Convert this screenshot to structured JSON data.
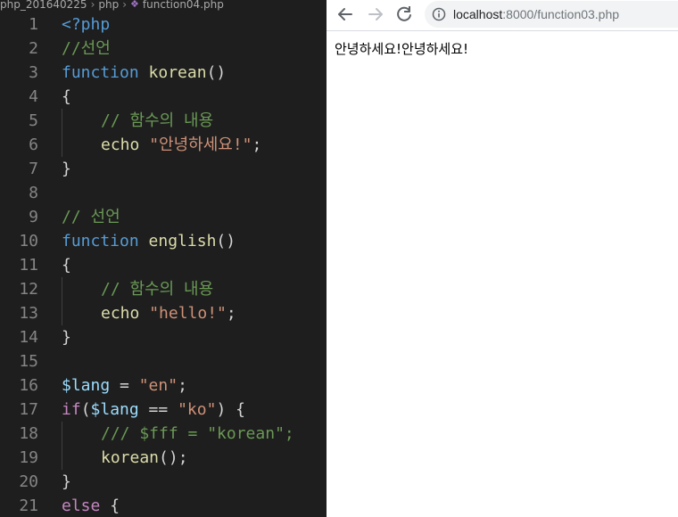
{
  "editor": {
    "breadcrumb": {
      "folder": "php_201640225",
      "subfolder": "php",
      "file": "function04.php"
    },
    "lines": [
      {
        "n": "1",
        "tokens": [
          {
            "c": "kw",
            "t": "<?php"
          }
        ]
      },
      {
        "n": "2",
        "tokens": [
          {
            "c": "cm",
            "t": "//선언"
          }
        ]
      },
      {
        "n": "3",
        "tokens": [
          {
            "c": "kw",
            "t": "function"
          },
          {
            "c": "op",
            "t": " "
          },
          {
            "c": "fn",
            "t": "korean"
          },
          {
            "c": "op",
            "t": "()"
          }
        ]
      },
      {
        "n": "4",
        "tokens": [
          {
            "c": "op",
            "t": "{"
          }
        ]
      },
      {
        "n": "5",
        "indent": true,
        "tokens": [
          {
            "c": "cm",
            "t": "// 함수의 내용"
          }
        ]
      },
      {
        "n": "6",
        "indent": true,
        "tokens": [
          {
            "c": "fn",
            "t": "echo"
          },
          {
            "c": "op",
            "t": " "
          },
          {
            "c": "str",
            "t": "\"안녕하세요!\""
          },
          {
            "c": "op",
            "t": ";"
          }
        ]
      },
      {
        "n": "7",
        "tokens": [
          {
            "c": "op",
            "t": "}"
          }
        ]
      },
      {
        "n": "8",
        "tokens": []
      },
      {
        "n": "9",
        "tokens": [
          {
            "c": "cm",
            "t": "// 선언"
          }
        ]
      },
      {
        "n": "10",
        "tokens": [
          {
            "c": "kw",
            "t": "function"
          },
          {
            "c": "op",
            "t": " "
          },
          {
            "c": "fn",
            "t": "english"
          },
          {
            "c": "op",
            "t": "()"
          }
        ]
      },
      {
        "n": "11",
        "tokens": [
          {
            "c": "op",
            "t": "{"
          }
        ]
      },
      {
        "n": "12",
        "indent": true,
        "tokens": [
          {
            "c": "cm",
            "t": "// 함수의 내용"
          }
        ]
      },
      {
        "n": "13",
        "indent": true,
        "tokens": [
          {
            "c": "fn",
            "t": "echo"
          },
          {
            "c": "op",
            "t": " "
          },
          {
            "c": "str",
            "t": "\"hello!\""
          },
          {
            "c": "op",
            "t": ";"
          }
        ]
      },
      {
        "n": "14",
        "tokens": [
          {
            "c": "op",
            "t": "}"
          }
        ]
      },
      {
        "n": "15",
        "tokens": []
      },
      {
        "n": "16",
        "tokens": [
          {
            "c": "var",
            "t": "$lang"
          },
          {
            "c": "op",
            "t": " = "
          },
          {
            "c": "str",
            "t": "\"en\""
          },
          {
            "c": "op",
            "t": ";"
          }
        ]
      },
      {
        "n": "17",
        "tokens": [
          {
            "c": "ctl",
            "t": "if"
          },
          {
            "c": "op",
            "t": "("
          },
          {
            "c": "var",
            "t": "$lang"
          },
          {
            "c": "op",
            "t": " == "
          },
          {
            "c": "str",
            "t": "\"ko\""
          },
          {
            "c": "op",
            "t": ") {"
          }
        ]
      },
      {
        "n": "18",
        "indent": true,
        "tokens": [
          {
            "c": "cm",
            "t": "/// $fff = \"korean\";"
          }
        ]
      },
      {
        "n": "19",
        "indent": true,
        "tokens": [
          {
            "c": "fn",
            "t": "korean"
          },
          {
            "c": "op",
            "t": "();"
          }
        ]
      },
      {
        "n": "20",
        "tokens": [
          {
            "c": "op",
            "t": "}"
          }
        ]
      },
      {
        "n": "21",
        "tokens": [
          {
            "c": "ctl",
            "t": "else"
          },
          {
            "c": "op",
            "t": " {"
          }
        ]
      }
    ]
  },
  "browser": {
    "url_host": "localhost",
    "url_path": ":8000/function03.php",
    "page_text": "안녕하세요!안녕하세요!"
  },
  "colors": {
    "editor_bg": "#1e1e1e",
    "keyword": "#569cd6",
    "function": "#dcdcaa",
    "string": "#ce9178",
    "comment": "#6a9955",
    "variable": "#9cdcfe",
    "control": "#c586c0"
  },
  "icons": {
    "back": "arrow-left-icon",
    "forward": "arrow-right-icon",
    "reload": "reload-icon",
    "info": "info-icon",
    "php_file": "php-file-icon"
  }
}
